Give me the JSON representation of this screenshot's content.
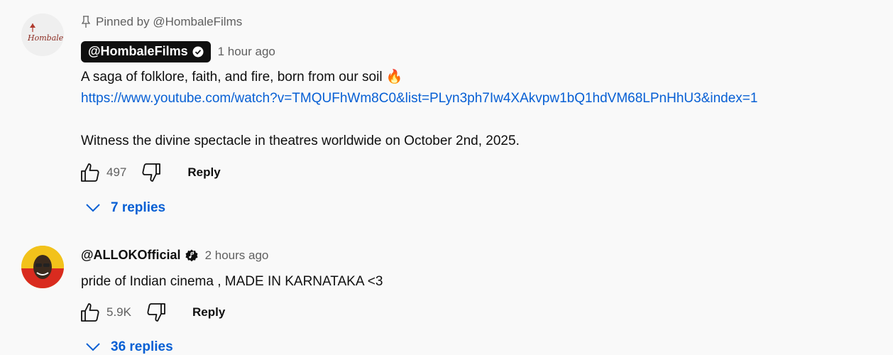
{
  "comments": [
    {
      "pinned_text": "Pinned by @HombaleFilms",
      "avatar_text": "Hombale",
      "author": "@HombaleFilms",
      "verified_icon": "check-circle-icon",
      "time": "1 hour ago",
      "lines": [
        "A saga of folklore, faith, and fire, born from our soil 🔥",
        "https://www.youtube.com/watch?v=TMQUFhWm8C0&list=PLyn3ph7Iw4XAkvpw1bQ1hdVM68LPnHhU3&index=1",
        "Witness the divine spectacle in theatres worldwide on October 2nd, 2025."
      ],
      "likes": "497",
      "reply_label": "Reply",
      "replies_label": "7 replies"
    },
    {
      "author": "@ALLOKOfficial",
      "verified_icon": "music-note-badge-icon",
      "time": "2 hours ago",
      "lines": [
        "pride of Indian cinema , MADE IN KARNATAKA <3"
      ],
      "likes": "5.9K",
      "reply_label": "Reply",
      "replies_label": "36 replies"
    }
  ],
  "colors": {
    "background": "#f9f9f9",
    "link": "#065fd4",
    "muted": "#606060",
    "chip": "#0f0f0f"
  }
}
